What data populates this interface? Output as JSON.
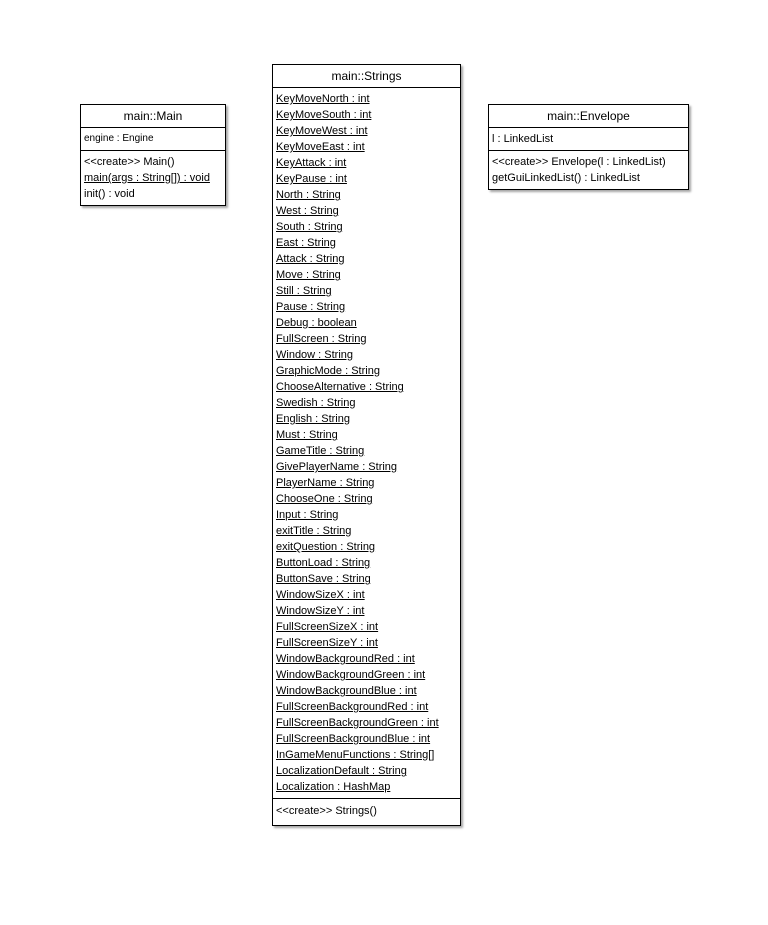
{
  "diagram": {
    "classes": {
      "main_class": {
        "name": "main::Main",
        "attributes": [
          {
            "text": "engine : Engine",
            "static": false
          }
        ],
        "operations": [
          {
            "text": "<<create>> Main()",
            "static": false
          },
          {
            "text": "main(args : String[]) : void",
            "static": true
          },
          {
            "text": "init() : void",
            "static": false
          }
        ]
      },
      "strings_class": {
        "name": "main::Strings",
        "attributes": [
          {
            "text": "KeyMoveNorth : int",
            "static": true
          },
          {
            "text": "KeyMoveSouth : int",
            "static": true
          },
          {
            "text": "KeyMoveWest : int",
            "static": true
          },
          {
            "text": "KeyMoveEast : int",
            "static": true
          },
          {
            "text": "KeyAttack : int",
            "static": true
          },
          {
            "text": "KeyPause : int",
            "static": true
          },
          {
            "text": "North : String",
            "static": true
          },
          {
            "text": "West : String",
            "static": true
          },
          {
            "text": "South : String",
            "static": true
          },
          {
            "text": "East : String",
            "static": true
          },
          {
            "text": "Attack : String",
            "static": true
          },
          {
            "text": "Move : String",
            "static": true
          },
          {
            "text": "Still : String",
            "static": true
          },
          {
            "text": "Pause : String",
            "static": true
          },
          {
            "text": "Debug : boolean",
            "static": true
          },
          {
            "text": "FullScreen : String",
            "static": true
          },
          {
            "text": "Window : String",
            "static": true
          },
          {
            "text": "GraphicMode : String",
            "static": true
          },
          {
            "text": "ChooseAlternative : String",
            "static": true
          },
          {
            "text": "Swedish : String",
            "static": true
          },
          {
            "text": "English : String",
            "static": true
          },
          {
            "text": "Must : String",
            "static": true
          },
          {
            "text": "GameTitle : String",
            "static": true
          },
          {
            "text": "GivePlayerName : String",
            "static": true
          },
          {
            "text": "PlayerName : String",
            "static": true
          },
          {
            "text": "ChooseOne : String",
            "static": true
          },
          {
            "text": "Input : String",
            "static": true
          },
          {
            "text": "exitTitle : String",
            "static": true
          },
          {
            "text": "exitQuestion : String",
            "static": true
          },
          {
            "text": "ButtonLoad : String",
            "static": true
          },
          {
            "text": "ButtonSave : String",
            "static": true
          },
          {
            "text": "WindowSizeX : int",
            "static": true
          },
          {
            "text": "WindowSizeY : int",
            "static": true
          },
          {
            "text": "FullScreenSizeX : int",
            "static": true
          },
          {
            "text": "FullScreenSizeY : int",
            "static": true
          },
          {
            "text": "WindowBackgroundRed : int",
            "static": true
          },
          {
            "text": "WindowBackgroundGreen : int",
            "static": true
          },
          {
            "text": "WindowBackgroundBlue : int",
            "static": true
          },
          {
            "text": "FullScreenBackgroundRed : int",
            "static": true
          },
          {
            "text": "FullScreenBackgroundGreen : int",
            "static": true
          },
          {
            "text": "FullScreenBackgroundBlue : int",
            "static": true
          },
          {
            "text": "InGameMenuFunctions : String[]",
            "static": true
          },
          {
            "text": "LocalizationDefault : String",
            "static": true
          },
          {
            "text": "Localization : HashMap",
            "static": true
          }
        ],
        "operations": [
          {
            "text": "<<create>> Strings()",
            "static": false
          }
        ]
      },
      "envelope_class": {
        "name": "main::Envelope",
        "attributes": [
          {
            "text": "l : LinkedList",
            "static": false
          }
        ],
        "operations": [
          {
            "text": "<<create>> Envelope(l : LinkedList)",
            "static": false
          },
          {
            "text": "getGuiLinkedList() : LinkedList",
            "static": false
          }
        ]
      }
    }
  }
}
